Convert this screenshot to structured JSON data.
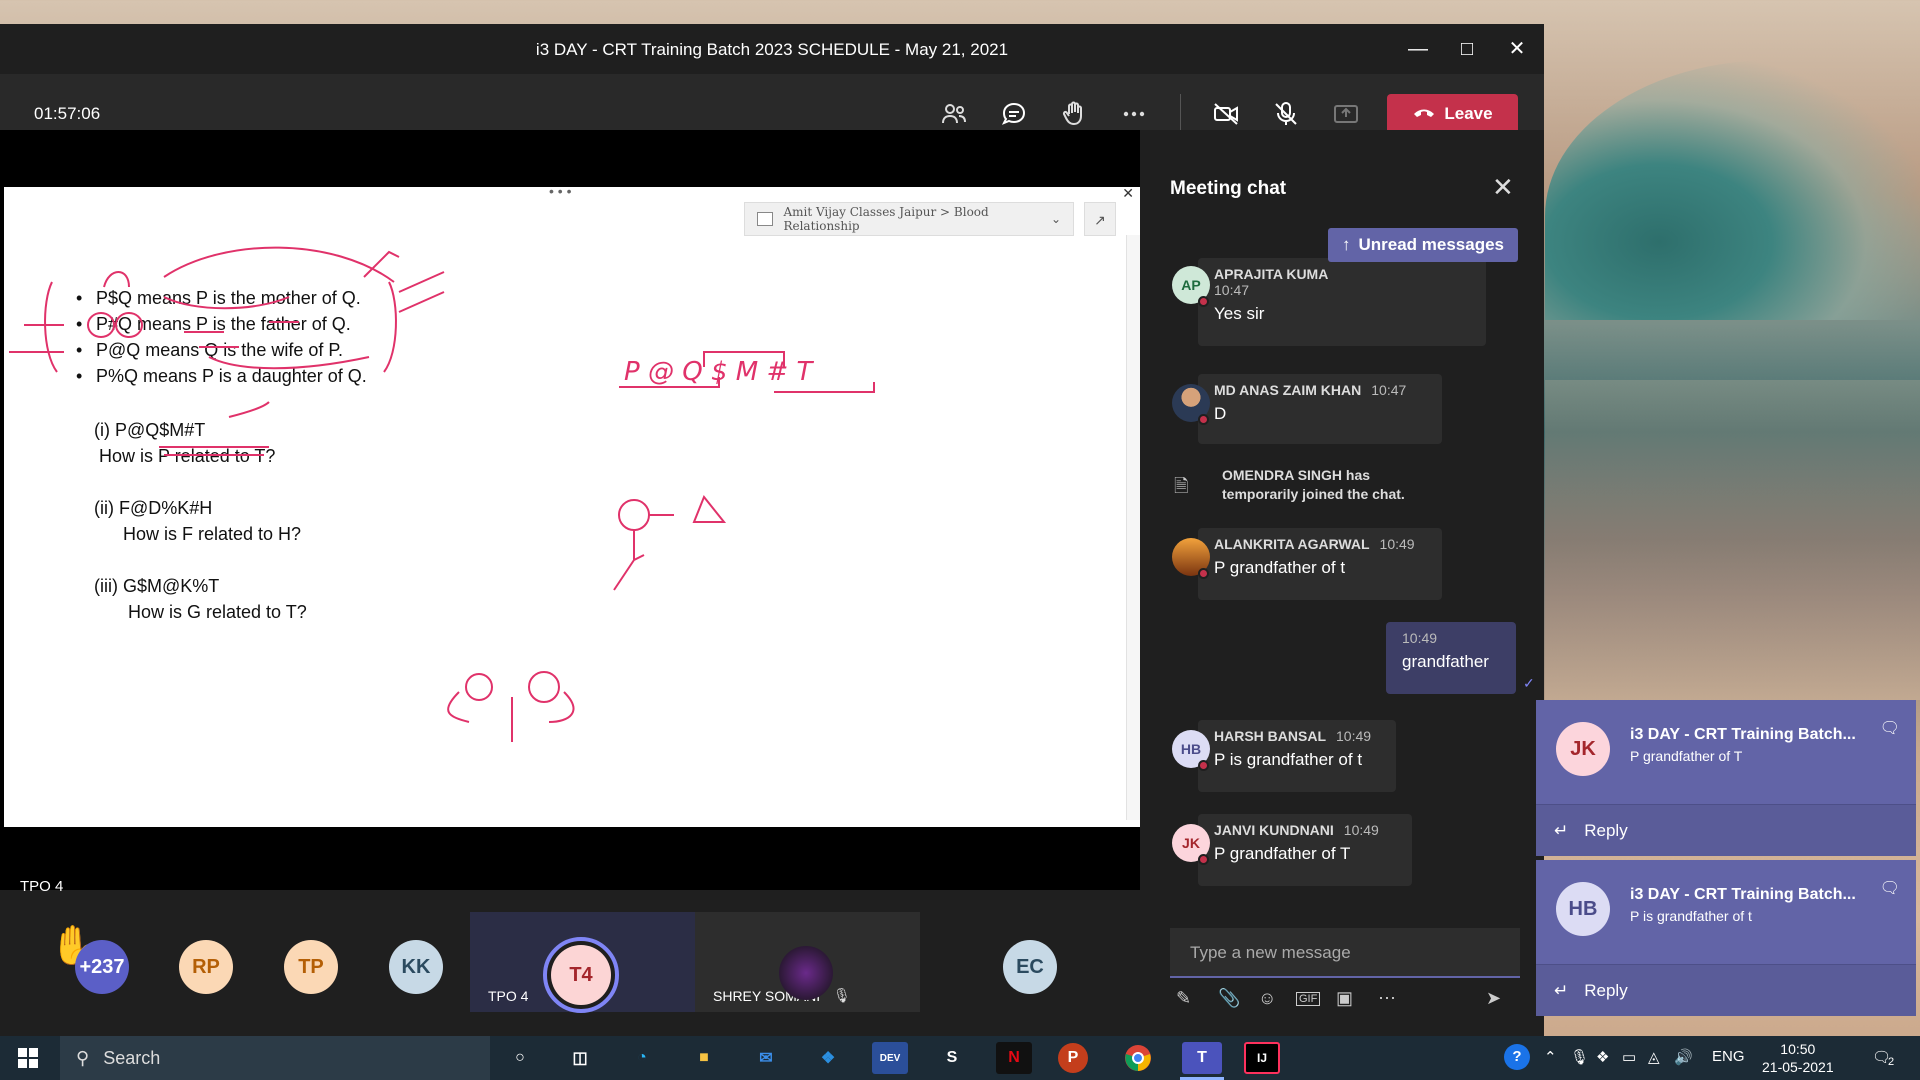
{
  "window": {
    "title": "i3 DAY - CRT Training Batch 2023 SCHEDULE - May 21, 2021"
  },
  "toolbar": {
    "timer": "01:57:06",
    "leave_label": "Leave"
  },
  "share": {
    "breadcrumb": "Amit Vijay Classes Jaipur > Blood Relationship",
    "bullets": [
      "P$Q means P is the mother of Q.",
      "P#Q means P is the father of Q.",
      "P@Q means Q is the wife of P.",
      "P%Q means P is a daughter of Q."
    ],
    "questions": [
      {
        "code": "(i) P@Q$M#T",
        "question": "How is P related to T?"
      },
      {
        "code": "(ii) F@D%K#H",
        "question": "How is F related to H?"
      },
      {
        "code": "(iii) G$M@K%T",
        "question": "How is G related to T?"
      }
    ],
    "ink_expr": "P @ Q $ M # T"
  },
  "presenter_label": "TPO 4",
  "participants": [
    {
      "initials": "+237",
      "bg": "#5b5fc7",
      "fg": "#ffffff"
    },
    {
      "initials": "RP",
      "bg": "#fbd8b5",
      "fg": "#b45f06"
    },
    {
      "initials": "TP",
      "bg": "#fbd8b5",
      "fg": "#b45f06"
    },
    {
      "initials": "KK",
      "bg": "#c7d9e6",
      "fg": "#2b4a5f"
    },
    {
      "initials": "T4",
      "bg": "#fcd5d5",
      "fg": "#a4262c",
      "tile_label": "TPO 4"
    },
    {
      "initials": "",
      "tile_label": "SHREY SOMANI"
    },
    {
      "initials": "EC",
      "bg": "#c7d9e6",
      "fg": "#2b4a5f"
    }
  ],
  "chat": {
    "title": "Meeting chat",
    "unread_label": "Unread messages",
    "messages": [
      {
        "initials": "AP",
        "name": "APRAJITA KUMA",
        "time": "10:47",
        "text": "Yes sir",
        "bg": "#cfe8d8",
        "fg": "#1e6b3d"
      },
      {
        "initials": "",
        "name": "MD ANAS ZAIM KHAN",
        "time": "10:47",
        "text": "D"
      },
      {
        "initials": "",
        "name": "ALANKRITA AGARWAL",
        "time": "10:49",
        "text": "P grandfather of t"
      },
      {
        "initials": "",
        "name": "",
        "time": "10:49",
        "text": "grandfather"
      },
      {
        "initials": "HB",
        "name": "HARSH BANSAL",
        "time": "10:49",
        "text": "P is grandfather of t",
        "bg": "#dcdcf4",
        "fg": "#4b4c8a"
      },
      {
        "initials": "JK",
        "name": "JANVI KUNDNANI",
        "time": "10:49",
        "text": "P grandfather of T",
        "bg": "#fcd5dc",
        "fg": "#a4262c"
      }
    ],
    "system_line1": "OMENDRA SINGH has",
    "system_line2": "temporarily joined the chat.",
    "compose_placeholder": "Type a new message"
  },
  "notifications": [
    {
      "initials": "JK",
      "title": "i3 DAY - CRT Training Batch...",
      "body": "P grandfather of T",
      "reply": "Reply",
      "bg": "#fcd5dc",
      "fg": "#a4262c"
    },
    {
      "initials": "HB",
      "title": "i3 DAY - CRT Training Batch...",
      "body": "P is grandfather of t",
      "reply": "Reply",
      "bg": "#dcdcf4",
      "fg": "#4b4c8a"
    }
  ],
  "taskbar": {
    "search_label": "Search",
    "lang": "ENG",
    "time": "10:50",
    "date": "21-05-2021",
    "notif_count": "2",
    "apps": [
      "cortana-icon",
      "task-view-icon",
      "edge-icon",
      "file-explorer-icon",
      "mail-icon",
      "vscode-icon",
      "devcpp-icon",
      "sublime-icon",
      "netflix-icon",
      "powerpoint-icon",
      "chrome-icon",
      "teams-icon",
      "intellij-icon"
    ]
  }
}
